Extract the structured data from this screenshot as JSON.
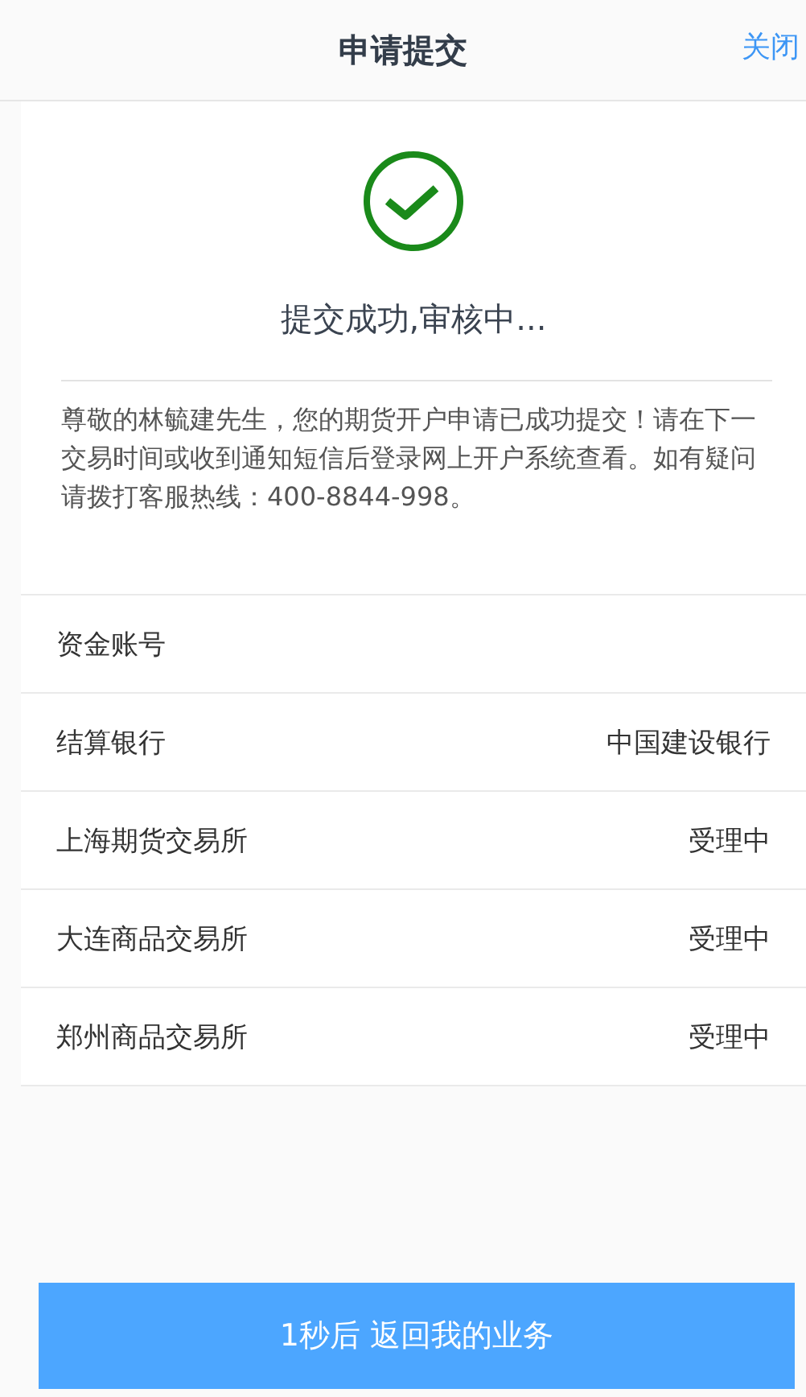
{
  "header": {
    "title": "申请提交",
    "close": "关闭"
  },
  "result": {
    "title": "提交成功,审核中...",
    "message": "尊敬的林毓建先生，您的期货开户申请已成功提交！请在下一交易时间或收到通知短信后登录网上开户系统查看。如有疑问请拨打客服热线：400-8844-998。"
  },
  "rows": [
    {
      "label": "资金账号"
    },
    {
      "label": "结算银行",
      "value": "中国建设银行"
    },
    {
      "label": "上海期货交易所",
      "value": "受理中"
    },
    {
      "label": "大连商品交易所",
      "value": "受理中"
    },
    {
      "label": "郑州商品交易所",
      "value": "受理中"
    }
  ],
  "button": "1秒后 返回我的业务"
}
